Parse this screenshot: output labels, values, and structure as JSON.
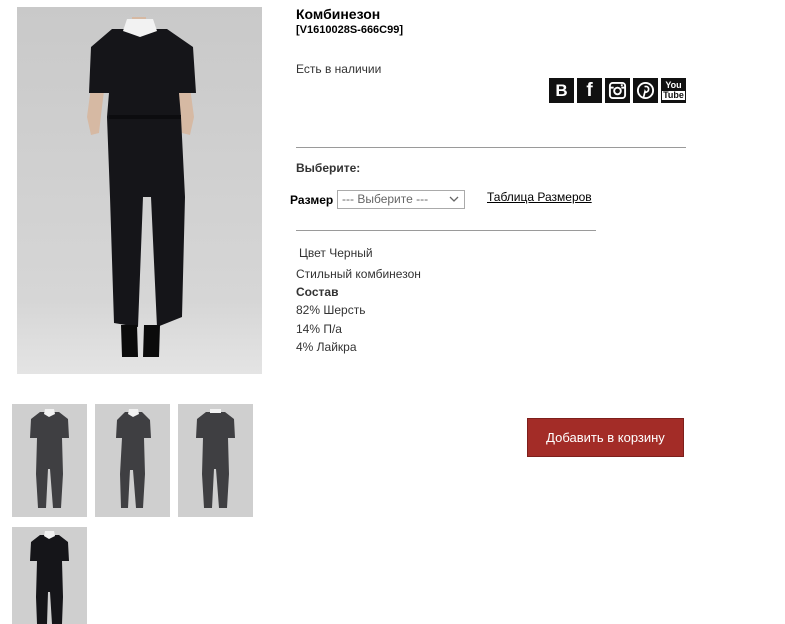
{
  "product": {
    "title": "Комбинезон",
    "sku": "[V1610028S-666C99]",
    "stock": "Есть в наличии"
  },
  "social": [
    {
      "icon": "vk-icon",
      "glyph": "В"
    },
    {
      "icon": "facebook-icon",
      "glyph": "f"
    },
    {
      "icon": "instagram-icon"
    },
    {
      "icon": "pinterest-icon"
    },
    {
      "icon": "youtube-icon",
      "glyph_top": "You",
      "glyph_bottom": "Tube"
    }
  ],
  "options": {
    "choose_label": "Выберите:",
    "size_label": "Размер",
    "size_select_value": "--- Выберите ---",
    "size_table_link": "Таблица Размеров"
  },
  "description": {
    "color_line": "Цвет Черный",
    "style_line": "Стильный комбинезон",
    "composition_title": "Состав",
    "composition": [
      "82% Шерсть",
      "14% П/а",
      "4% Лайкра"
    ]
  },
  "cart": {
    "button_label": "Добавить в корзину"
  },
  "colors": {
    "accent_button": "#a32c27",
    "garment": "#151519"
  }
}
